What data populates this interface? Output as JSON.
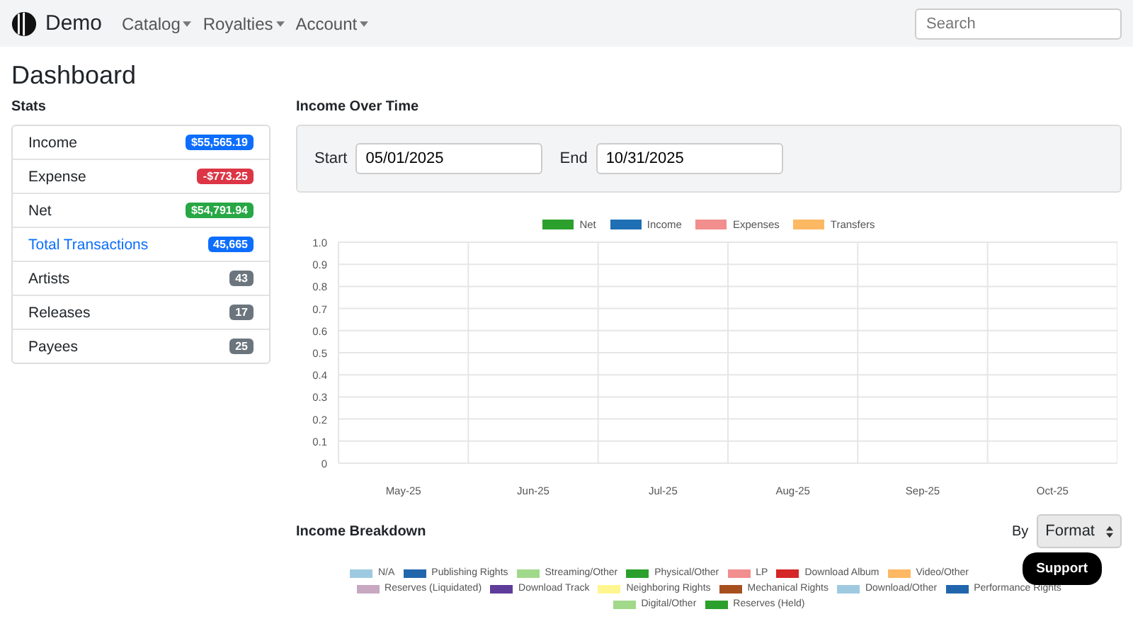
{
  "navbar": {
    "brand": "Demo",
    "menus": [
      "Catalog",
      "Royalties",
      "Account"
    ],
    "search": {
      "placeholder": "Search"
    }
  },
  "page_title": "Dashboard",
  "stats": {
    "title": "Stats",
    "items": [
      {
        "label": "Income",
        "kind": "text",
        "badge": "$55,565.19",
        "color": "#0d6efd"
      },
      {
        "label": "Expense",
        "kind": "text",
        "badge": "-$773.25",
        "color": "#dc3545"
      },
      {
        "label": "Net",
        "kind": "text",
        "badge": "$54,791.94",
        "color": "#28a745"
      },
      {
        "label": "Total Transactions",
        "kind": "link",
        "badge": "45,665",
        "color": "#0d6efd"
      },
      {
        "label": "Artists",
        "kind": "text",
        "badge": "43",
        "color": "#6c757d"
      },
      {
        "label": "Releases",
        "kind": "text",
        "badge": "17",
        "color": "#6c757d"
      },
      {
        "label": "Payees",
        "kind": "text",
        "badge": "25",
        "color": "#6c757d"
      }
    ]
  },
  "income_over_time": {
    "title": "Income Over Time",
    "start": {
      "label": "Start",
      "value": "05/01/2025"
    },
    "end": {
      "label": "End",
      "value": "10/31/2025"
    },
    "chart_data": {
      "type": "bar",
      "grid": true,
      "categories": [
        "May-25",
        "Jun-25",
        "Jul-25",
        "Aug-25",
        "Sep-25",
        "Oct-25"
      ],
      "series": [
        {
          "name": "Net",
          "color": "#2ca02c",
          "values": [
            null,
            null,
            null,
            null,
            null,
            null
          ]
        },
        {
          "name": "Income",
          "color": "#1f6fb4",
          "values": [
            null,
            null,
            null,
            null,
            null,
            null
          ]
        },
        {
          "name": "Expenses",
          "color": "#f28e8e",
          "values": [
            null,
            null,
            null,
            null,
            null,
            null
          ]
        },
        {
          "name": "Transfers",
          "color": "#fdb863",
          "values": [
            null,
            null,
            null,
            null,
            null,
            null
          ]
        }
      ],
      "ylim": [
        0,
        1
      ],
      "yticks": [
        0,
        {
          "value": 0.1,
          "label": "0.1"
        },
        {
          "value": 0.2,
          "label": "0.2"
        },
        {
          "value": 0.3,
          "label": "0.3"
        },
        {
          "value": 0.4,
          "label": "0.4"
        },
        {
          "value": 0.5,
          "label": "0.5"
        },
        {
          "value": 0.6,
          "label": "0.6"
        },
        {
          "value": 0.7,
          "label": "0.7"
        },
        {
          "value": 0.8,
          "label": "0.8"
        },
        {
          "value": 0.9,
          "label": "0.9"
        },
        {
          "value": 1,
          "label": "1.0"
        }
      ]
    }
  },
  "income_breakdown": {
    "title": "Income Breakdown",
    "by_label": "By",
    "by_value": "Format",
    "legend": [
      {
        "label": "N/A",
        "color": "#9ecae1"
      },
      {
        "label": "Publishing Rights",
        "color": "#2166ac"
      },
      {
        "label": "Streaming/Other",
        "color": "#a1d98a"
      },
      {
        "label": "Physical/Other",
        "color": "#2ca02c"
      },
      {
        "label": "LP",
        "color": "#f28e8e"
      },
      {
        "label": "Download Album",
        "color": "#d62728"
      },
      {
        "label": "Video/Other",
        "color": "#fdb863"
      },
      {
        "label": "Reserves (Liquidated)",
        "color": "#c7a8c0"
      },
      {
        "label": "Download Track",
        "color": "#5e3c99"
      },
      {
        "label": "Neighboring Rights",
        "color": "#fff68f"
      },
      {
        "label": "Mechanical Rights",
        "color": "#a6501f"
      },
      {
        "label": "Download/Other",
        "color": "#9ecae1"
      },
      {
        "label": "Performance Rights",
        "color": "#2166ac"
      },
      {
        "label": "Digital/Other",
        "color": "#a1d98a"
      },
      {
        "label": "Reserves (Held)",
        "color": "#2ca02c"
      }
    ]
  },
  "support_button": "Support"
}
